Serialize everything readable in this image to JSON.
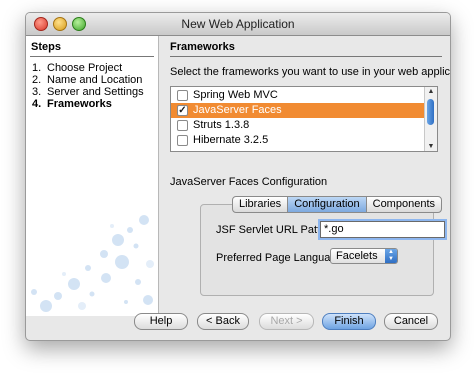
{
  "window": {
    "title": "New Web Application"
  },
  "steps": {
    "heading": "Steps",
    "items": [
      {
        "num": "1.",
        "label": "Choose Project"
      },
      {
        "num": "2.",
        "label": "Name and Location"
      },
      {
        "num": "3.",
        "label": "Server and Settings"
      },
      {
        "num": "4.",
        "label": "Frameworks"
      }
    ],
    "active_index": 3
  },
  "frameworks": {
    "heading": "Frameworks",
    "description": "Select the frameworks you want to use in your web application.",
    "list": [
      {
        "label": "Spring Web MVC",
        "checked": false,
        "selected": false
      },
      {
        "label": "JavaServer Faces",
        "checked": true,
        "selected": true
      },
      {
        "label": "Struts 1.3.8",
        "checked": false,
        "selected": false
      },
      {
        "label": "Hibernate 3.2.5",
        "checked": false,
        "selected": false
      }
    ]
  },
  "config": {
    "heading": "JavaServer Faces Configuration",
    "tabs": [
      {
        "label": "Libraries"
      },
      {
        "label": "Configuration"
      },
      {
        "label": "Components"
      }
    ],
    "active_tab": "Configuration",
    "servlet_pattern_label": "JSF Servlet URL Pattern:",
    "servlet_pattern_value": "*.go",
    "page_language_label": "Preferred Page Language:",
    "page_language_value": "Facelets"
  },
  "buttons": {
    "help": "Help",
    "back": "< Back",
    "next": "Next >",
    "finish": "Finish",
    "cancel": "Cancel"
  },
  "colors": {
    "selection": "#f18b32",
    "accent": "#2f6fc4"
  }
}
